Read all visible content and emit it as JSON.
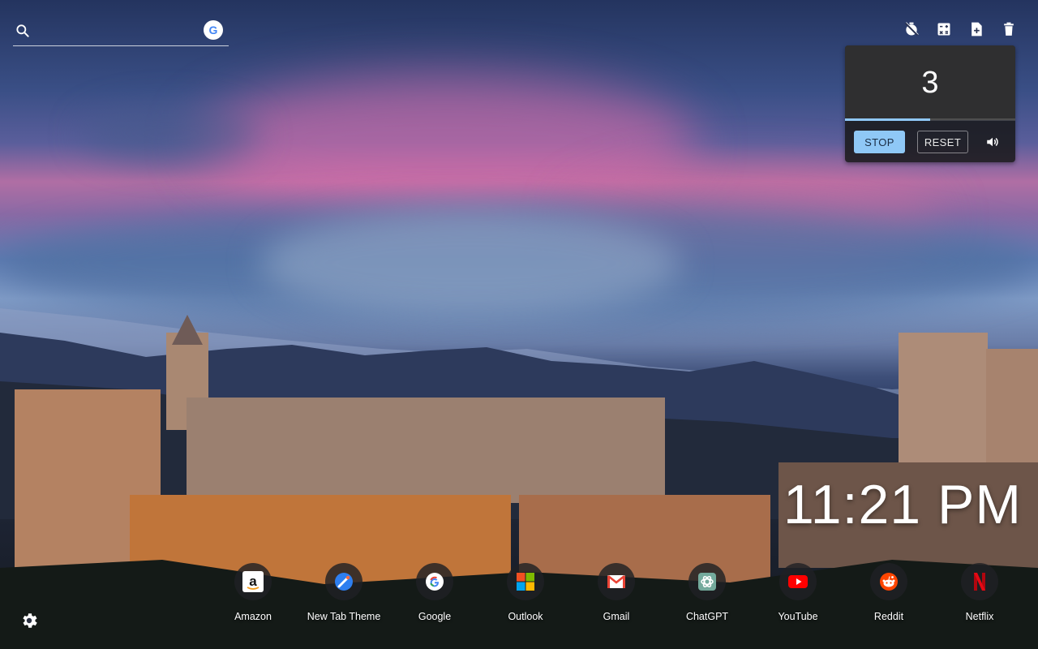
{
  "search": {
    "placeholder": "",
    "engine_icon": "google-icon"
  },
  "toolbar": {
    "icons": [
      "timer-off-icon",
      "calculator-icon",
      "note-add-icon",
      "trash-icon"
    ]
  },
  "timer": {
    "value": "3",
    "progress": 0.5,
    "stop_label": "STOP",
    "reset_label": "RESET",
    "volume_icon": "volume-icon"
  },
  "clock": {
    "time": "11:21 PM"
  },
  "shortcuts": [
    {
      "label": "Amazon",
      "icon": "amazon-icon"
    },
    {
      "label": "New Tab Theme",
      "icon": "new-tab-theme-icon"
    },
    {
      "label": "Google",
      "icon": "google-icon"
    },
    {
      "label": "Outlook",
      "icon": "windows-icon"
    },
    {
      "label": "Gmail",
      "icon": "gmail-icon"
    },
    {
      "label": "ChatGPT",
      "icon": "chatgpt-icon"
    },
    {
      "label": "YouTube",
      "icon": "youtube-icon"
    },
    {
      "label": "Reddit",
      "icon": "reddit-icon"
    },
    {
      "label": "Netflix",
      "icon": "netflix-icon"
    }
  ],
  "settings": {
    "icon": "gear-icon"
  },
  "colors": {
    "accent": "#90c8f9",
    "timer_bg": "#303030"
  }
}
